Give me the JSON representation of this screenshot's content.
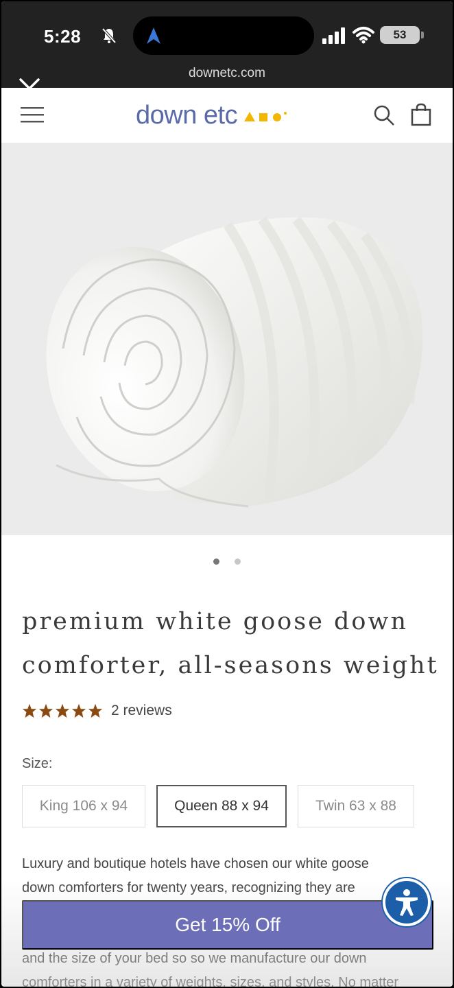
{
  "status_bar": {
    "time": "5:28",
    "battery": "53"
  },
  "browser": {
    "url": "downetc.com"
  },
  "header": {
    "logo_text": "down etc",
    "logo_colors": [
      "#f2b705",
      "#f2b705",
      "#f2b705"
    ]
  },
  "gallery": {
    "slides": 2,
    "active": 1
  },
  "product": {
    "title_line1": "premium white goose down",
    "title_line2": "comforter, all-seasons weight",
    "rating": 5,
    "reviews": "2 reviews",
    "size_label": "Size:",
    "sizes": [
      {
        "label": "King 106 x 94",
        "selected": false
      },
      {
        "label": "Queen 88 x 94",
        "selected": true
      },
      {
        "label": "Twin 63 x 88",
        "selected": false
      }
    ],
    "desc_line1": "Luxury and boutique hotels have chosen our white goose",
    "desc_line2": "down comforters for twenty years, recognizing they are",
    "desc_line3": "and the size of your bed so so we manufacture our down",
    "desc_line4": "comforters in a variety of weights, sizes, and styles. No matter"
  },
  "promo": {
    "cta_label": "Get 15% Off"
  },
  "colors": {
    "brand": "#5a6aa8",
    "cta": "#6c6fb8",
    "star": "#8a4a12",
    "accessibility": "#1c5ea8"
  }
}
